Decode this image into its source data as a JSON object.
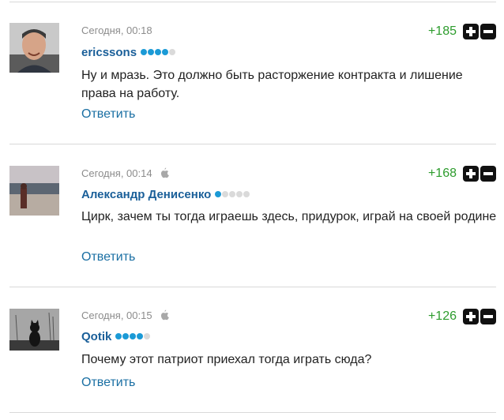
{
  "comments": [
    {
      "timestamp": "Сегодня, 00:18",
      "device_icon": "",
      "author": "ericssons",
      "rating_dots": 5,
      "rating_filled": 4,
      "score": "+185",
      "text": "Ну и мразь. Это должно быть расторжение контракта и лишение права на работу.",
      "reply_label": "Ответить"
    },
    {
      "timestamp": "Сегодня, 00:14",
      "device_icon": "apple-icon",
      "author": "Александр Денисенко",
      "rating_dots": 5,
      "rating_filled": 1,
      "score": "+168",
      "text": "Цирк, зачем ты тогда играешь здесь, придурок, играй на своей родине",
      "reply_label": "Ответить"
    },
    {
      "timestamp": "Сегодня, 00:15",
      "device_icon": "apple-icon",
      "author": "Qotik",
      "rating_dots": 5,
      "rating_filled": 4,
      "score": "+126",
      "text": "Почему этот патриот приехал тогда играть сюда?",
      "reply_label": "Ответить"
    }
  ],
  "colors": {
    "author": "#1a5f99",
    "reply": "#1a6fa3",
    "score_positive": "#2d9c2d",
    "rating_on": "#1b9ad6",
    "rating_off": "#dadada"
  }
}
